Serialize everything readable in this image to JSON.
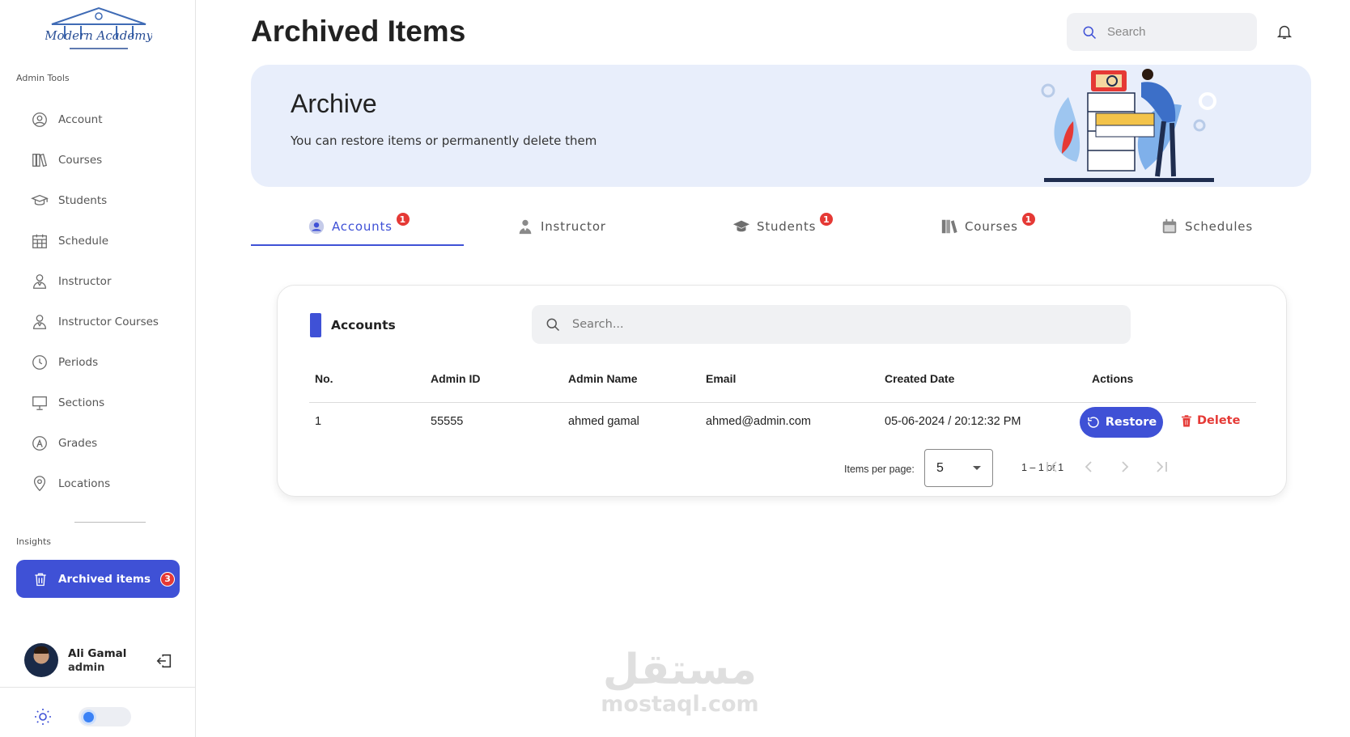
{
  "sidebar": {
    "logo_text": "Modern Academy",
    "admin_tools_label": "Admin Tools",
    "insights_label": "Insights",
    "items": [
      {
        "label": "Account",
        "icon": "user-circle-icon"
      },
      {
        "label": "Courses",
        "icon": "books-icon"
      },
      {
        "label": "Students",
        "icon": "graduation-cap-icon"
      },
      {
        "label": "Schedule",
        "icon": "calendar-icon"
      },
      {
        "label": "Instructor",
        "icon": "instructor-icon"
      },
      {
        "label": "Instructor Courses",
        "icon": "instructor-icon"
      },
      {
        "label": "Periods",
        "icon": "clock-icon"
      },
      {
        "label": "Sections",
        "icon": "presentation-icon"
      },
      {
        "label": "Grades",
        "icon": "grade-icon"
      },
      {
        "label": "Locations",
        "icon": "location-pin-icon"
      }
    ],
    "archived": {
      "label": "Archived items",
      "count": "3"
    },
    "user": {
      "name": "Ali Gamal",
      "role": "admin"
    }
  },
  "header": {
    "title": "Archived Items",
    "search_placeholder": "Search"
  },
  "banner": {
    "title": "Archive",
    "subtitle": "You can restore items or permanently delete them"
  },
  "tabs": [
    {
      "label": "Accounts",
      "badge": "1",
      "active": true
    },
    {
      "label": "Instructor",
      "badge": null,
      "active": false
    },
    {
      "label": "Students",
      "badge": "1",
      "active": false
    },
    {
      "label": "Courses",
      "badge": "1",
      "active": false
    },
    {
      "label": "Schedules",
      "badge": null,
      "active": false
    }
  ],
  "table": {
    "title": "Accounts",
    "search_placeholder": "Search...",
    "columns": [
      "No.",
      "Admin ID",
      "Admin Name",
      "Email",
      "Created Date",
      "Actions"
    ],
    "rows": [
      {
        "no": "1",
        "admin_id": "55555",
        "admin_name": "ahmed gamal",
        "email": "ahmed@admin.com",
        "created": "05-06-2024 / 20:12:32 PM"
      }
    ],
    "actions": {
      "restore": "Restore",
      "delete": "Delete"
    },
    "paginator": {
      "items_per_page_label": "Items per page:",
      "page_size": "5",
      "range": "1 – 1 of 1"
    }
  },
  "watermark": {
    "arabic": "مستقل",
    "latin": "mostaql.com"
  },
  "colors": {
    "accent": "#3f51d6",
    "danger": "#e53935",
    "banner_bg": "#e8eefb"
  }
}
